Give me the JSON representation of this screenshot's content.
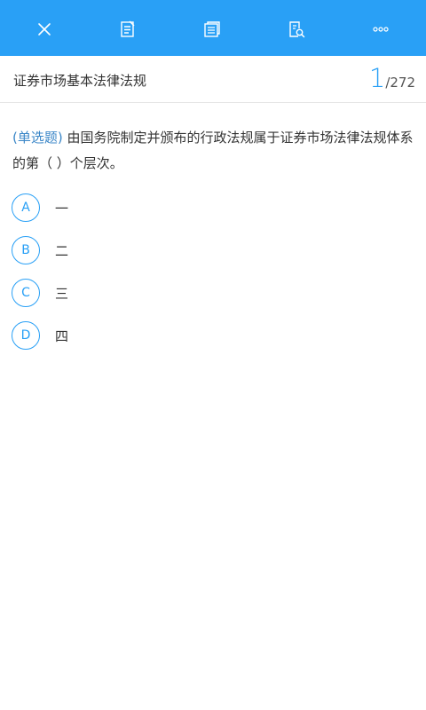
{
  "colors": {
    "toolbar_bg": "#29a0f6",
    "accent": "#29a0f6",
    "question_type": "#3b87c8"
  },
  "toolbar": {
    "buttons": [
      {
        "icon": "close-icon"
      },
      {
        "icon": "notes-icon"
      },
      {
        "icon": "card-stack-icon"
      },
      {
        "icon": "search-document-icon"
      },
      {
        "icon": "more-icon"
      }
    ]
  },
  "header": {
    "subject": "证券市场基本法律法规",
    "current": "1",
    "total": "/272"
  },
  "question": {
    "type_label": "(单选题)",
    "text": " 由国务院制定并颁布的行政法规属于证券市场法律法规体系的第（  ）个层次。"
  },
  "options": [
    {
      "letter": "A",
      "text": "一"
    },
    {
      "letter": "B",
      "text": "二"
    },
    {
      "letter": "C",
      "text": "三"
    },
    {
      "letter": "D",
      "text": "四"
    }
  ]
}
